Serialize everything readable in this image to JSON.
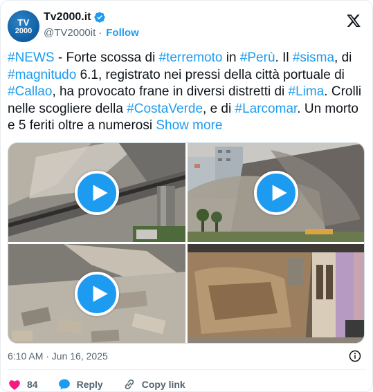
{
  "account": {
    "avatar_line1": "TV",
    "avatar_line2": "2000",
    "display_name": "Tv2000.it",
    "handle": "@TV2000it",
    "separator": "·",
    "follow_label": "Follow"
  },
  "tweet": {
    "segments": [
      {
        "text": "#NEWS",
        "type": "hashtag"
      },
      {
        "text": " - Forte scossa di ",
        "type": "text"
      },
      {
        "text": "#terremoto",
        "type": "hashtag"
      },
      {
        "text": " in ",
        "type": "text"
      },
      {
        "text": "#Perù",
        "type": "hashtag"
      },
      {
        "text": ". Il ",
        "type": "text"
      },
      {
        "text": "#sisma",
        "type": "hashtag"
      },
      {
        "text": ", di ",
        "type": "text"
      },
      {
        "text": "#magnitudo",
        "type": "hashtag"
      },
      {
        "text": " 6.1,  registrato nei pressi della città portuale di ",
        "type": "text"
      },
      {
        "text": "#Callao",
        "type": "hashtag"
      },
      {
        "text": ", ha provocato frane in diversi distretti di ",
        "type": "text"
      },
      {
        "text": "#Lima",
        "type": "hashtag"
      },
      {
        "text": ". Crolli nelle scogliere della ",
        "type": "text"
      },
      {
        "text": "#CostaVerde",
        "type": "hashtag"
      },
      {
        "text": ", e di ",
        "type": "text"
      },
      {
        "text": "#Larcomar",
        "type": "hashtag"
      },
      {
        "text": ". Un morto e 5 feriti oltre a numerosi ",
        "type": "text"
      }
    ],
    "show_more_label": "Show more"
  },
  "media": {
    "items": [
      {
        "kind": "video",
        "description": "landslide dust near highway overpass"
      },
      {
        "kind": "video",
        "description": "cliff collapse dust cloud near buildings"
      },
      {
        "kind": "video",
        "description": "fallen bricks and rubble on street"
      },
      {
        "kind": "image",
        "description": "damaged adobe wall in street"
      }
    ]
  },
  "meta": {
    "timestamp": "6:10 AM · Jun 16, 2025"
  },
  "actions": {
    "like_count": "84",
    "reply_label": "Reply",
    "copy_link_label": "Copy link"
  },
  "colors": {
    "accent": "#1d9bf0",
    "like": "#f91880",
    "text": "#0f1419",
    "secondary": "#536471"
  },
  "icons": {
    "verified": "verified-badge-icon",
    "platform": "x-logo-icon",
    "play": "play-icon",
    "info": "info-icon",
    "like": "heart-icon",
    "reply": "reply-bubble-icon",
    "copy_link": "link-icon"
  }
}
